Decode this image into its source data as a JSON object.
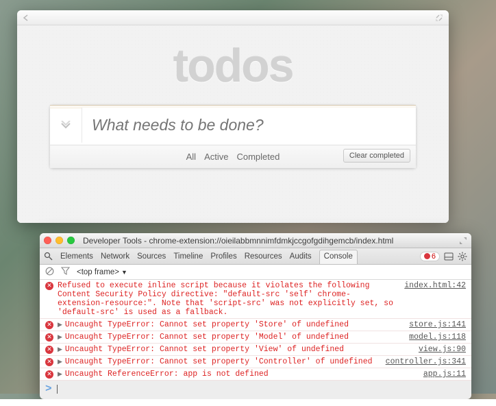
{
  "todos": {
    "heading": "todos",
    "placeholder": "What needs to be done?",
    "filters": {
      "all": "All",
      "active": "Active",
      "completed": "Completed"
    },
    "clear": "Clear completed"
  },
  "devtools": {
    "title": "Developer Tools - chrome-extension://oieilabbmnnimfdmkjccgofgdihgemcb/index.html",
    "tabs": {
      "elements": "Elements",
      "network": "Network",
      "sources": "Sources",
      "timeline": "Timeline",
      "profiles": "Profiles",
      "resources": "Resources",
      "audits": "Audits",
      "console": "Console"
    },
    "error_count": "6",
    "frame_selector": "<top frame>",
    "console": [
      {
        "expandable": false,
        "msg": "Refused to execute inline script because it violates the following Content Security Policy directive: \"default-src 'self' chrome-extension-resource:\". Note that 'script-src' was not explicitly set, so 'default-src' is used as a fallback.",
        "loc": "index.html:42"
      },
      {
        "expandable": true,
        "msg": "Uncaught TypeError: Cannot set property 'Store' of undefined",
        "loc": "store.js:141"
      },
      {
        "expandable": true,
        "msg": "Uncaught TypeError: Cannot set property 'Model' of undefined",
        "loc": "model.js:118"
      },
      {
        "expandable": true,
        "msg": "Uncaught TypeError: Cannot set property 'View' of undefined",
        "loc": "view.js:90"
      },
      {
        "expandable": true,
        "msg": "Uncaught TypeError: Cannot set property 'Controller' of undefined",
        "loc": "controller.js:341"
      },
      {
        "expandable": true,
        "msg": "Uncaught ReferenceError: app is not defined",
        "loc": "app.js:11"
      }
    ],
    "prompt": ">"
  }
}
